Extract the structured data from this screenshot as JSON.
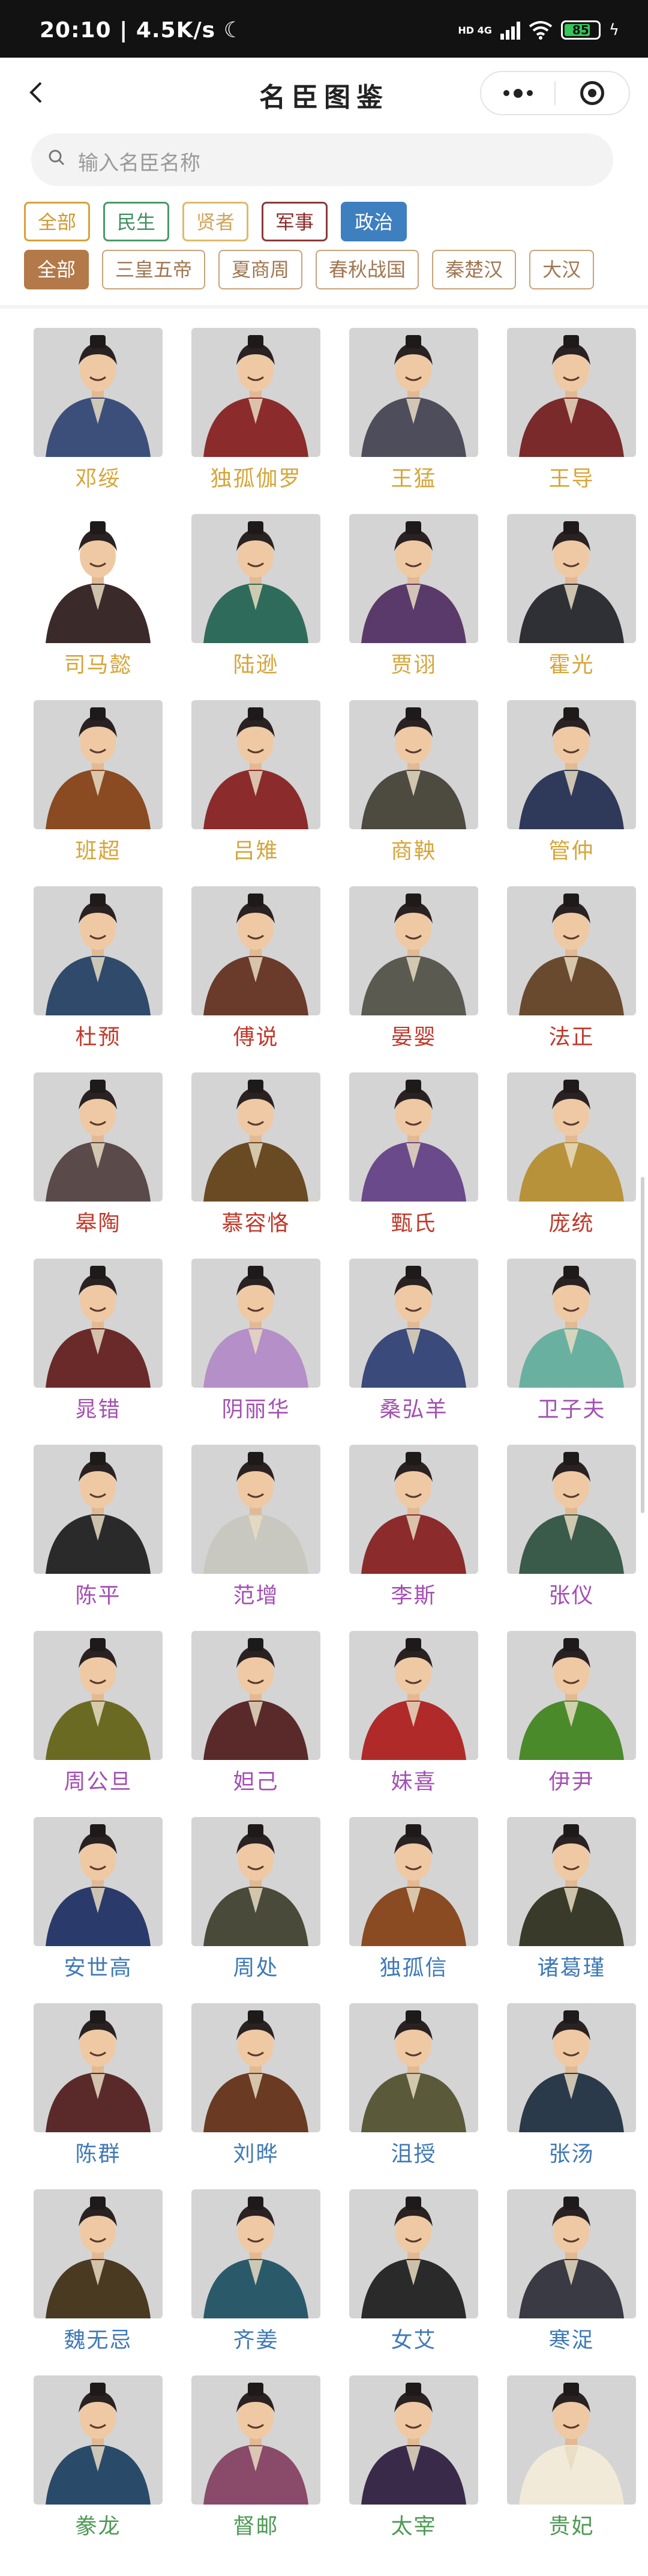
{
  "status_bar": {
    "time": "20:10",
    "speed": "4.5K/s",
    "network": "HD 4G",
    "battery": "85"
  },
  "nav": {
    "title": "名臣图鉴"
  },
  "search": {
    "placeholder": "输入名臣名称"
  },
  "type_filters": [
    {
      "label": "全部"
    },
    {
      "label": "民生"
    },
    {
      "label": "贤者"
    },
    {
      "label": "军事"
    },
    {
      "label": "政治",
      "active": true
    }
  ],
  "era_filters": [
    {
      "label": "全部",
      "active": true
    },
    {
      "label": "三皇五帝"
    },
    {
      "label": "夏商周"
    },
    {
      "label": "春秋战国"
    },
    {
      "label": "秦楚汉"
    },
    {
      "label": "大汉"
    }
  ],
  "colors": {
    "gold": "#d6a53a",
    "red": "#c0392b",
    "purple": "#a44fb3",
    "blue": "#3f79b8",
    "green": "#4e9a55"
  },
  "ministers": [
    {
      "name": "邓绥",
      "tier": "gold",
      "robe": "#3b4f7a"
    },
    {
      "name": "独孤伽罗",
      "tier": "gold",
      "robe": "#8b2b2b"
    },
    {
      "name": "王猛",
      "tier": "gold",
      "robe": "#4d4d5c"
    },
    {
      "name": "王导",
      "tier": "gold",
      "robe": "#7a2a2a"
    },
    {
      "name": "司马懿",
      "tier": "gold",
      "robe": "#3a2a2a"
    },
    {
      "name": "陆逊",
      "tier": "gold",
      "robe": "#2f6b5a"
    },
    {
      "name": "贾诩",
      "tier": "gold",
      "robe": "#5a3a6a"
    },
    {
      "name": "霍光",
      "tier": "gold",
      "robe": "#2f2f36"
    },
    {
      "name": "班超",
      "tier": "gold",
      "robe": "#8a4a22"
    },
    {
      "name": "吕雉",
      "tier": "gold",
      "robe": "#8b2b2b"
    },
    {
      "name": "商鞅",
      "tier": "gold",
      "robe": "#4d4a40"
    },
    {
      "name": "管仲",
      "tier": "gold",
      "robe": "#2f3a5a"
    },
    {
      "name": "杜预",
      "tier": "red",
      "robe": "#2f4a6a"
    },
    {
      "name": "傅说",
      "tier": "red",
      "robe": "#6a3a2a"
    },
    {
      "name": "晏婴",
      "tier": "red",
      "robe": "#5a5a50"
    },
    {
      "name": "法正",
      "tier": "red",
      "robe": "#6a4a2f"
    },
    {
      "name": "皋陶",
      "tier": "red",
      "robe": "#5a4a4a"
    },
    {
      "name": "慕容恪",
      "tier": "red",
      "robe": "#6a4a22"
    },
    {
      "name": "甄氏",
      "tier": "red",
      "robe": "#6a4a8a"
    },
    {
      "name": "庞统",
      "tier": "red",
      "robe": "#b8923a"
    },
    {
      "name": "晁错",
      "tier": "purple",
      "robe": "#6a2a2a"
    },
    {
      "name": "阴丽华",
      "tier": "purple",
      "robe": "#b48fc8"
    },
    {
      "name": "桑弘羊",
      "tier": "purple",
      "robe": "#3a4a7a"
    },
    {
      "name": "卫子夫",
      "tier": "purple",
      "robe": "#6ab0a0"
    },
    {
      "name": "陈平",
      "tier": "purple",
      "robe": "#2a2a2a"
    },
    {
      "name": "范增",
      "tier": "purple",
      "robe": "#c8c8c0"
    },
    {
      "name": "李斯",
      "tier": "purple",
      "robe": "#8b2b2b"
    },
    {
      "name": "张仪",
      "tier": "purple",
      "robe": "#3a5a4a"
    },
    {
      "name": "周公旦",
      "tier": "purple",
      "robe": "#6a6a22"
    },
    {
      "name": "妲己",
      "tier": "purple",
      "robe": "#5a2a2a"
    },
    {
      "name": "妹喜",
      "tier": "purple",
      "robe": "#b02a2a"
    },
    {
      "name": "伊尹",
      "tier": "purple",
      "robe": "#4a8a2a"
    },
    {
      "name": "安世高",
      "tier": "blue",
      "robe": "#2a3a6a"
    },
    {
      "name": "周处",
      "tier": "blue",
      "robe": "#4a4a3a"
    },
    {
      "name": "独孤信",
      "tier": "blue",
      "robe": "#8a4a22"
    },
    {
      "name": "诸葛瑾",
      "tier": "blue",
      "robe": "#3a3a2a"
    },
    {
      "name": "陈群",
      "tier": "blue",
      "robe": "#5a2a2a"
    },
    {
      "name": "刘晔",
      "tier": "blue",
      "robe": "#6a3a22"
    },
    {
      "name": "沮授",
      "tier": "blue",
      "robe": "#5a5a3a"
    },
    {
      "name": "张汤",
      "tier": "blue",
      "robe": "#2a3a4a"
    },
    {
      "name": "魏无忌",
      "tier": "blue",
      "robe": "#4a3a22"
    },
    {
      "name": "齐姜",
      "tier": "blue",
      "robe": "#2a5a6a"
    },
    {
      "name": "女艾",
      "tier": "blue",
      "robe": "#2a2a2a"
    },
    {
      "name": "寒浞",
      "tier": "blue",
      "robe": "#3a3a44"
    },
    {
      "name": "豢龙",
      "tier": "green",
      "robe": "#2a4a6a"
    },
    {
      "name": "督邮",
      "tier": "green",
      "robe": "#8a4a6a"
    },
    {
      "name": "太宰",
      "tier": "green",
      "robe": "#3a2a4a"
    },
    {
      "name": "贵妃",
      "tier": "green",
      "robe": "#f2ead8"
    }
  ]
}
